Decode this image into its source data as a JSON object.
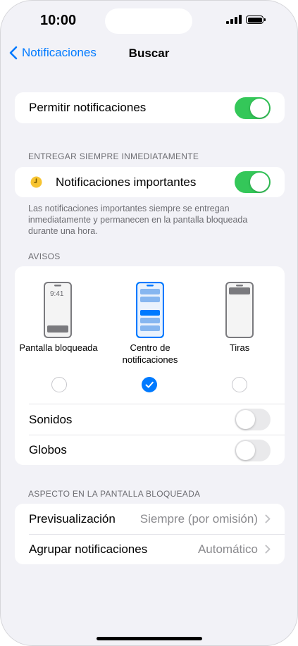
{
  "status_bar": {
    "time": "10:00"
  },
  "nav": {
    "back_label": "Notificaciones",
    "title": "Buscar"
  },
  "allow": {
    "label": "Permitir notificaciones",
    "enabled": true
  },
  "important": {
    "section_header": "ENTREGAR SIEMPRE INMEDIATAMENTE",
    "label": "Notificaciones importantes",
    "enabled": true,
    "footnote": "Las notificaciones importantes siempre se entregan inmediatamente y permanecen en la pantalla bloqueada durante una hora."
  },
  "alerts": {
    "section_header": "AVISOS",
    "options": [
      {
        "label": "Pantalla bloqueada",
        "preview_time": "9:41",
        "selected": false
      },
      {
        "label_line1": "Centro de",
        "label_line2": "notificaciones",
        "selected": true
      },
      {
        "label": "Tiras",
        "selected": false
      }
    ],
    "sounds": {
      "label": "Sonidos",
      "enabled": false
    },
    "badges": {
      "label": "Globos",
      "enabled": false
    }
  },
  "lock_screen": {
    "section_header": "ASPECTO EN LA PANTALLA BLOQUEADA",
    "preview": {
      "label": "Previsualización",
      "value": "Siempre (por omisión)"
    },
    "grouping": {
      "label": "Agrupar notificaciones",
      "value": "Automático"
    }
  },
  "colors": {
    "accent": "#007aff",
    "toggle_on": "#34c759",
    "toggle_off": "#e9e9eb",
    "background": "#f2f2f7",
    "important_icon": "#f7c431"
  }
}
